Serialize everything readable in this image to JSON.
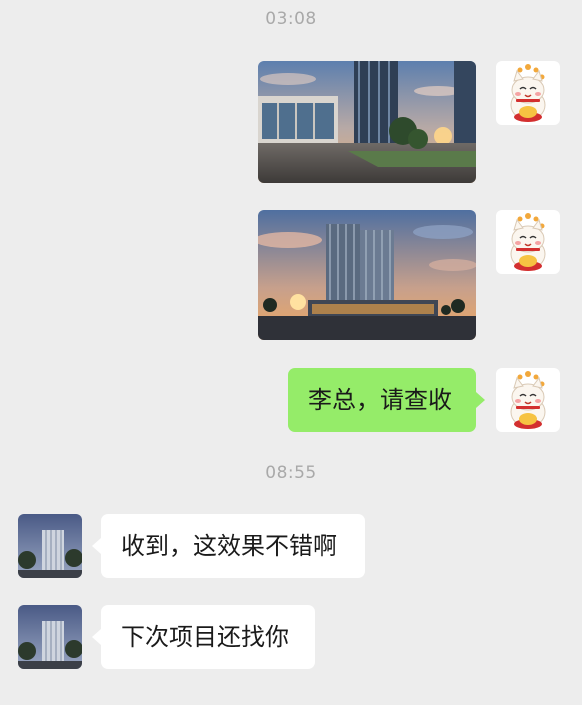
{
  "messages": {
    "time_1": "03:08",
    "time_2": "08:55",
    "sent_text": "李总，请查收",
    "reply_1": "收到，这效果不错啊",
    "reply_2": "下次项目还找你"
  },
  "colors": {
    "background": "#ededed",
    "sent_bubble": "#95ec69",
    "received_bubble": "#ffffff",
    "timestamp_text": "#a9a9a9"
  },
  "icons": {
    "self_avatar": "lucky-cat-icon",
    "contact_avatar": "building-photo-avatar"
  }
}
